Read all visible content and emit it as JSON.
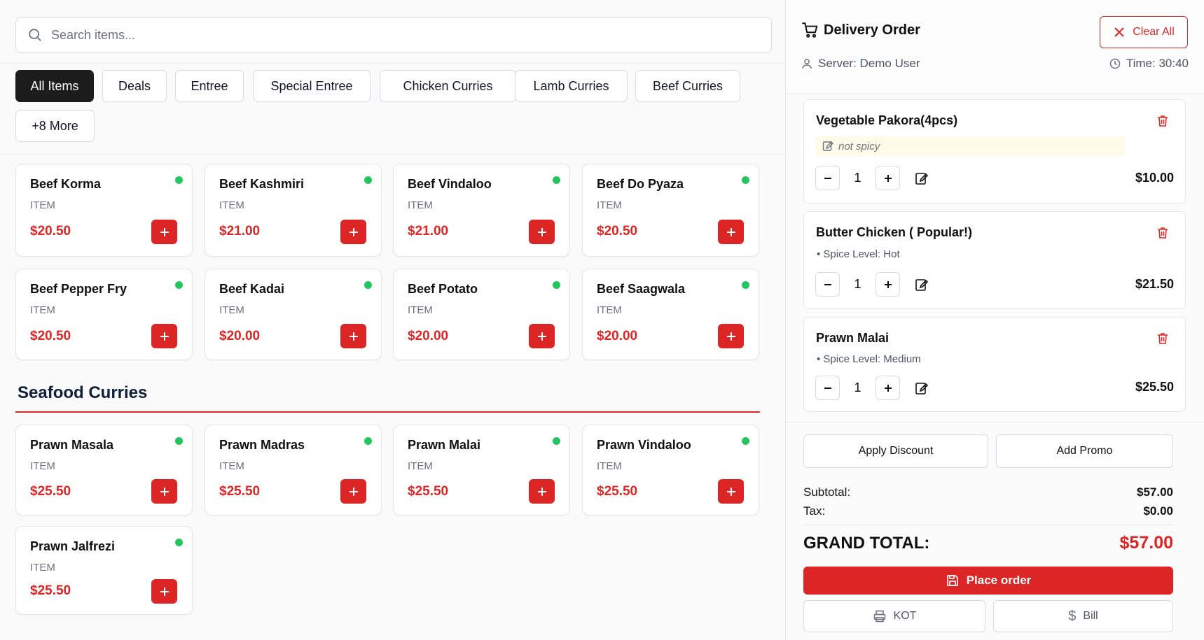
{
  "search": {
    "placeholder": "Search items..."
  },
  "categories": [
    "All Items",
    "Deals",
    "Entree",
    "Special Entree",
    "Chicken Curries",
    "Lamb Curries",
    "Beef Curries",
    "+8 More"
  ],
  "beef_items": [
    {
      "name": "Beef Korma",
      "type": "ITEM",
      "price": "$20.50"
    },
    {
      "name": "Beef Kashmiri",
      "type": "ITEM",
      "price": "$21.00"
    },
    {
      "name": "Beef Vindaloo",
      "type": "ITEM",
      "price": "$21.00"
    },
    {
      "name": "Beef Do Pyaza",
      "type": "ITEM",
      "price": "$20.50"
    },
    {
      "name": "Beef Pepper Fry",
      "type": "ITEM",
      "price": "$20.50"
    },
    {
      "name": "Beef Kadai",
      "type": "ITEM",
      "price": "$20.00"
    },
    {
      "name": "Beef Potato",
      "type": "ITEM",
      "price": "$20.00"
    },
    {
      "name": "Beef Saagwala",
      "type": "ITEM",
      "price": "$20.00"
    }
  ],
  "seafood": {
    "title": "Seafood Curries",
    "items": [
      {
        "name": "Prawn Masala",
        "type": "ITEM",
        "price": "$25.50"
      },
      {
        "name": "Prawn Madras",
        "type": "ITEM",
        "price": "$25.50"
      },
      {
        "name": "Prawn Malai",
        "type": "ITEM",
        "price": "$25.50"
      },
      {
        "name": "Prawn Vindaloo",
        "type": "ITEM",
        "price": "$25.50"
      },
      {
        "name": "Prawn Jalfrezi",
        "type": "ITEM",
        "price": "$25.50"
      }
    ]
  },
  "order": {
    "title": "Delivery Order",
    "clear_label": "Clear All",
    "server": "Server: Demo User",
    "time": "Time: 30:40",
    "items": [
      {
        "name": "Vegetable Pakora(4pcs)",
        "note": "not spicy",
        "qty": "1",
        "price": "$10.00"
      },
      {
        "name": "Butter Chicken ( Popular!)",
        "spice": "• Spice Level: Hot",
        "qty": "1",
        "price": "$21.50"
      },
      {
        "name": "Prawn Malai",
        "spice": "• Spice Level: Medium",
        "qty": "1",
        "price": "$25.50"
      }
    ],
    "apply_discount": "Apply Discount",
    "add_promo": "Add Promo",
    "subtotal_label": "Subtotal:",
    "subtotal": "$57.00",
    "tax_label": "Tax:",
    "tax": "$0.00",
    "grand_label": "GRAND TOTAL:",
    "grand": "$57.00",
    "place_label": "Place order",
    "kot_label": "KOT",
    "bill_label": "Bill"
  },
  "colors": {
    "accent": "#dc2626",
    "available": "#22c55e",
    "active_chip": "#1c1c1c"
  }
}
